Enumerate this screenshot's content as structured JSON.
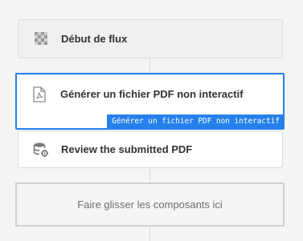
{
  "flow": {
    "start_step": {
      "label": "Début de flux",
      "icon": "checkerboard-icon"
    },
    "selected_step": {
      "label": "Générer un fichier PDF non interactif",
      "tooltip": "Générer un fichier PDF non interactif",
      "icon": "pdf-file-icon"
    },
    "review_step": {
      "label": "Review the submitted PDF",
      "icon": "database-gear-icon"
    },
    "dropzone": {
      "text": "Faire glisser les composants ici"
    }
  },
  "colors": {
    "accent": "#2680eb",
    "canvas": "#f5f5f5",
    "card": "#ffffff",
    "border": "#dcdcdc"
  }
}
